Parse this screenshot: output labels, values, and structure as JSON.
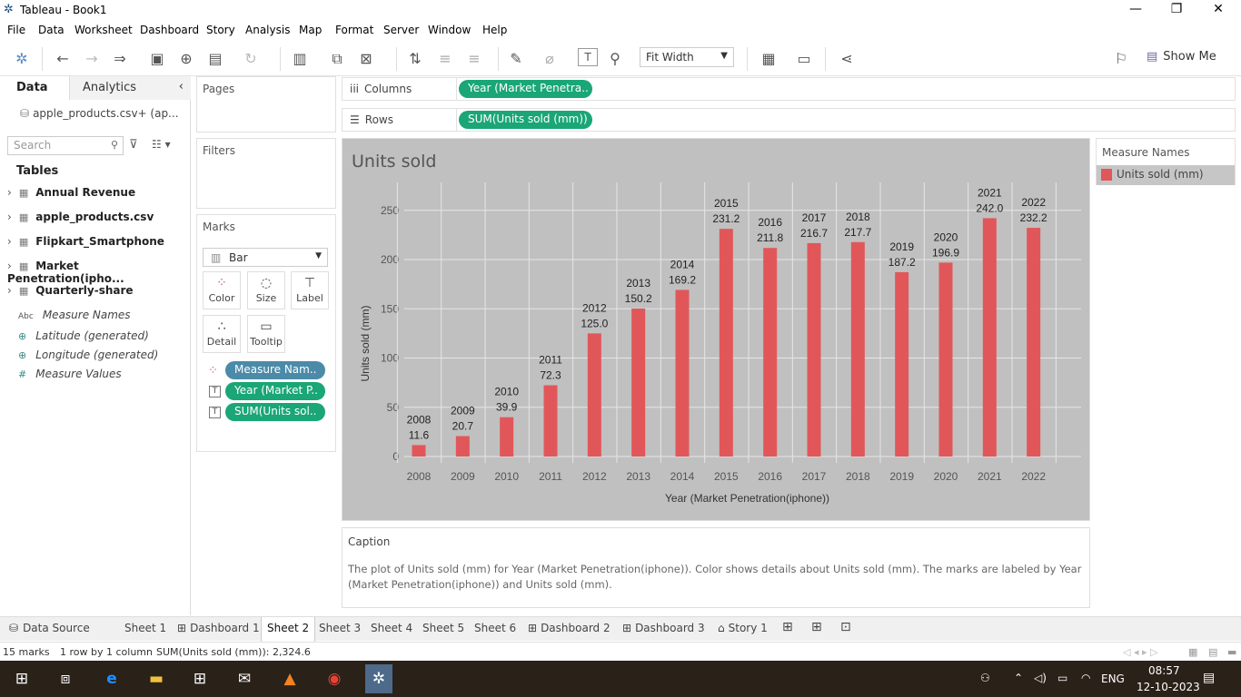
{
  "window": {
    "title": "Tableau - Book1"
  },
  "menu": [
    "File",
    "Data",
    "Worksheet",
    "Dashboard",
    "Story",
    "Analysis",
    "Map",
    "Format",
    "Server",
    "Window",
    "Help"
  ],
  "toolbar": {
    "fit": "Fit Width",
    "show_me": "Show Me"
  },
  "left_pane": {
    "tab_data": "Data",
    "tab_analytics": "Analytics",
    "datasource": "apple_products.csv+ (ap...",
    "search_placeholder": "Search",
    "tables_heading": "Tables",
    "tables": [
      "Annual Revenue",
      "apple_products.csv",
      "Flipkart_Smartphone",
      "Market Penetration(ipho...",
      "Quarterly-share"
    ],
    "fields": [
      {
        "icon": "Abc",
        "name": "Measure Names"
      },
      {
        "icon": "globe",
        "name": "Latitude (generated)"
      },
      {
        "icon": "globe",
        "name": "Longitude (generated)"
      },
      {
        "icon": "#",
        "name": "Measure Values"
      }
    ]
  },
  "cards": {
    "pages": "Pages",
    "filters": "Filters",
    "marks": "Marks",
    "mark_type": "Bar",
    "buttons": [
      "Color",
      "Size",
      "Label",
      "Detail",
      "Tooltip"
    ],
    "pills": [
      "Measure Nam..",
      "Year (Market P..",
      "SUM(Units sol.."
    ]
  },
  "shelves": {
    "columns_label": "Columns",
    "columns_pill": "Year (Market Penetra..",
    "rows_label": "Rows",
    "rows_pill": "SUM(Units sold (mm))"
  },
  "legend": {
    "title": "Measure Names",
    "item": "Units sold (mm)",
    "color": "#e15759"
  },
  "chart_data": {
    "type": "bar",
    "title": "Units sold",
    "xlabel": "Year (Market Penetration(iphone))",
    "ylabel": "Units sold (mm)",
    "ylim": [
      0,
      280
    ],
    "yticks": [
      0,
      50,
      100,
      150,
      200,
      250
    ],
    "categories": [
      "2008",
      "2009",
      "2010",
      "2011",
      "2012",
      "2013",
      "2014",
      "2015",
      "2016",
      "2017",
      "2018",
      "2019",
      "2020",
      "2021",
      "2022"
    ],
    "values": [
      11.6,
      20.7,
      39.9,
      72.3,
      125.0,
      150.2,
      169.2,
      231.2,
      211.8,
      216.7,
      217.7,
      187.2,
      196.9,
      242.0,
      232.2
    ],
    "value_labels": [
      "11.6",
      "20.7",
      "39.9",
      "72.3",
      "125.0",
      "150.2",
      "169.2",
      "231.2",
      "211.8",
      "216.7",
      "217.7",
      "187.2",
      "196.9",
      "242.0",
      "232.2"
    ],
    "bar_color": "#e15759",
    "background": "#c0c0c0",
    "grid": true,
    "legend": "right"
  },
  "caption": {
    "heading": "Caption",
    "text": "The plot of Units sold (mm) for Year (Market Penetration(iphone)).  Color shows details about Units sold (mm).  The marks are labeled by Year (Market Penetration(iphone)) and Units sold (mm)."
  },
  "sheet_tabs": [
    "Data Source",
    "Sheet 1",
    "Dashboard 1",
    "Sheet 2",
    "Sheet 3",
    "Sheet 4",
    "Sheet 5",
    "Sheet 6",
    "Dashboard 2",
    "Dashboard 3",
    "Story 1"
  ],
  "active_tab": "Sheet 2",
  "status": {
    "marks": "15 marks",
    "rows": "1 row by 1 column",
    "sum": "SUM(Units sold (mm)): 2,324.6"
  },
  "tray": {
    "lang": "ENG",
    "time": "08:57",
    "date": "12-10-2023"
  }
}
